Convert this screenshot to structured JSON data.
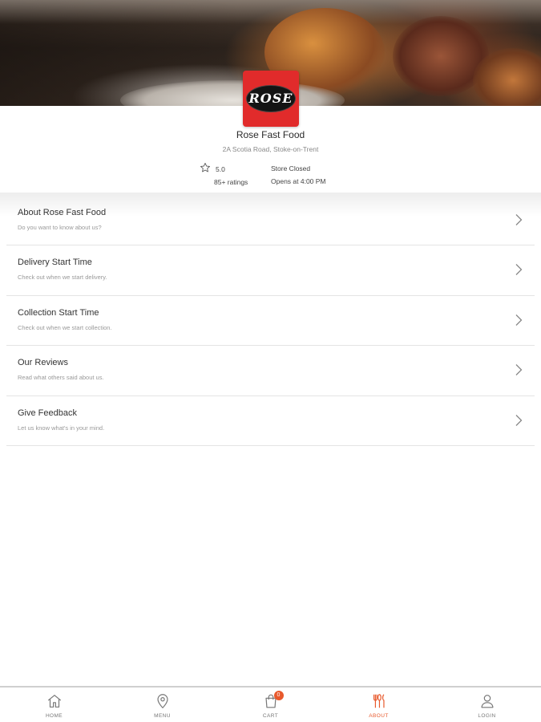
{
  "store": {
    "logo_text": "ROSE",
    "name": "Rose Fast Food",
    "address": "2A Scotia Road, Stoke-on-Trent",
    "rating": "5.0",
    "rating_count": "85+ ratings",
    "status": "Store Closed",
    "opens": "Opens at 4:00 PM"
  },
  "menu": {
    "items": [
      {
        "title": "About Rose Fast Food",
        "subtitle": "Do you want to know about us?"
      },
      {
        "title": "Delivery Start Time",
        "subtitle": "Check out when we start delivery."
      },
      {
        "title": "Collection Start Time",
        "subtitle": "Check out when we start collection."
      },
      {
        "title": "Our Reviews",
        "subtitle": "Read what others said about us."
      },
      {
        "title": "Give Feedback",
        "subtitle": "Let us know what's in your mind."
      }
    ]
  },
  "nav": {
    "home": "HOME",
    "menu": "MENU",
    "cart": "CART",
    "cart_count": "0",
    "about": "ABOUT",
    "login": "LOGIN",
    "active": "about"
  },
  "colors": {
    "accent": "#e8592c",
    "logo_bg": "#e12b2b"
  },
  "icons": {
    "home": "home-icon",
    "menu": "location-pin-icon",
    "cart": "shopping-bag-icon",
    "about": "utensils-icon",
    "login": "user-icon",
    "rating": "star-outline-icon",
    "chevron": "chevron-right-icon"
  }
}
